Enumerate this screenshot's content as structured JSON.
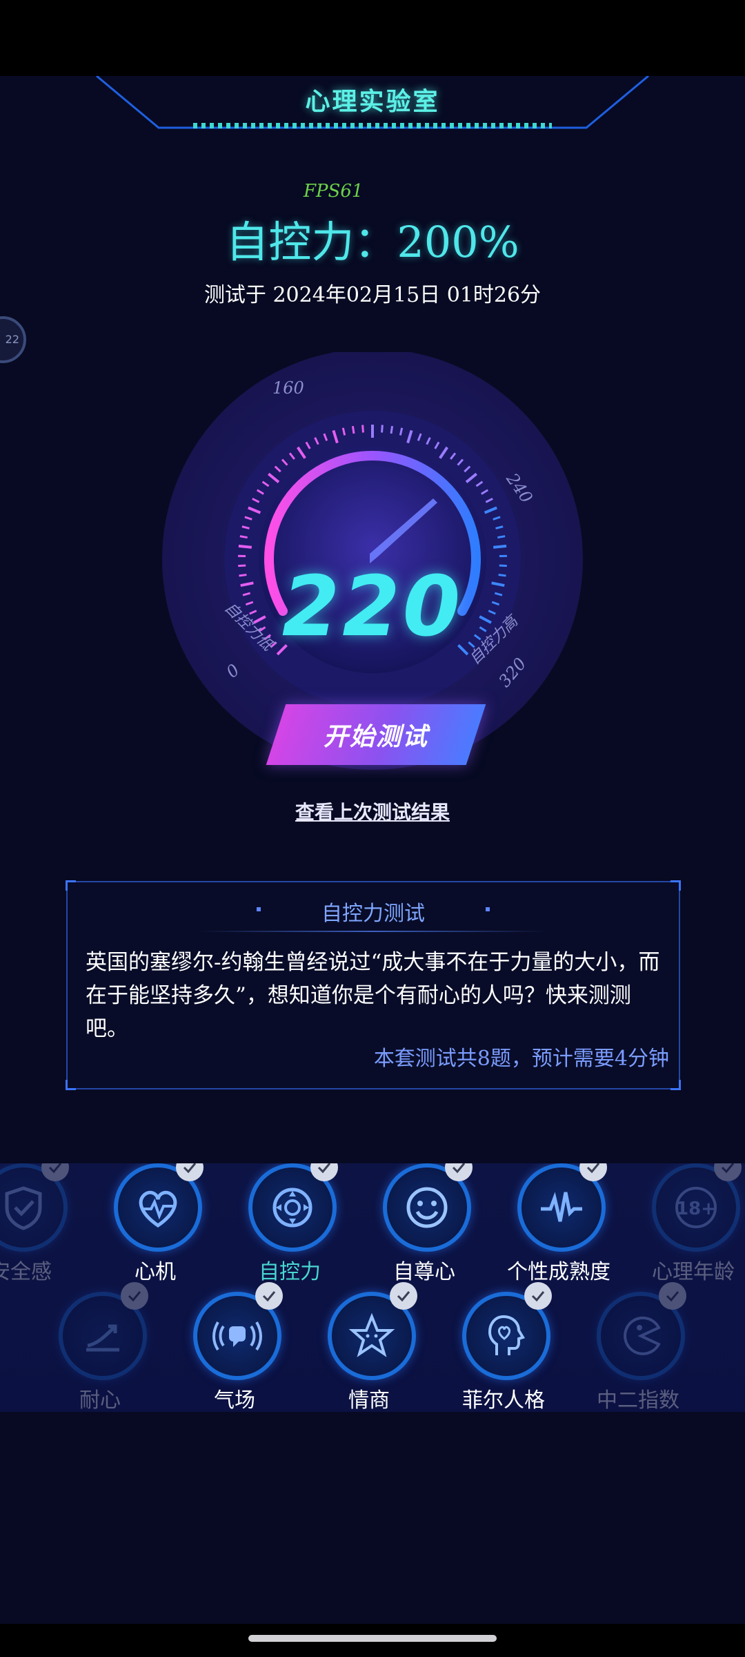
{
  "header": {
    "title": "心理实验室"
  },
  "fps": "FPS61",
  "result": {
    "score_line": "自控力：200%",
    "date_line": "测试于 2024年02月15日 01时26分"
  },
  "side_bubble": "22",
  "gauge": {
    "value": "220",
    "label_160": "160",
    "label_240": "240",
    "label_0": "0",
    "label_320": "320",
    "left_caption": "自控力低",
    "right_caption": "自控力高"
  },
  "start_button": "开始测试",
  "last_result_link": "查看上次测试结果",
  "intro_card": {
    "title": "自控力测试",
    "body": "英国的塞缪尔-约翰生曾经说过“成大事不在于力量的大小，而在于能坚持多久”，想知道你是个有耐心的人吗？快来测测吧。",
    "footer": "本套测试共8题，预计需要4分钟"
  },
  "tests_row1": [
    {
      "label": "安全感",
      "icon": "shield-icon",
      "faded": true
    },
    {
      "label": "心机",
      "icon": "heartbeat-icon",
      "faded": false
    },
    {
      "label": "自控力",
      "icon": "control-pad-icon",
      "faded": false,
      "selected": true
    },
    {
      "label": "自尊心",
      "icon": "smile-icon",
      "faded": false
    },
    {
      "label": "个性成熟度",
      "icon": "pulse-icon",
      "faded": false
    },
    {
      "label": "心理年龄",
      "icon": "age-18-icon",
      "faded": true
    }
  ],
  "tests_row2": [
    {
      "label": "耐心",
      "icon": "trend-icon",
      "faded": true
    },
    {
      "label": "气场",
      "icon": "aura-icon",
      "faded": false
    },
    {
      "label": "情商",
      "icon": "star-face-icon",
      "faded": false
    },
    {
      "label": "菲尔人格",
      "icon": "head-heart-icon",
      "faded": false
    },
    {
      "label": "中二指数",
      "icon": "pacman-icon",
      "faded": true
    }
  ],
  "age_badge_text": "18+",
  "colors": {
    "accent_cyan": "#4fe7ea",
    "button_start": "#d445e6",
    "button_end": "#4b7bff"
  }
}
